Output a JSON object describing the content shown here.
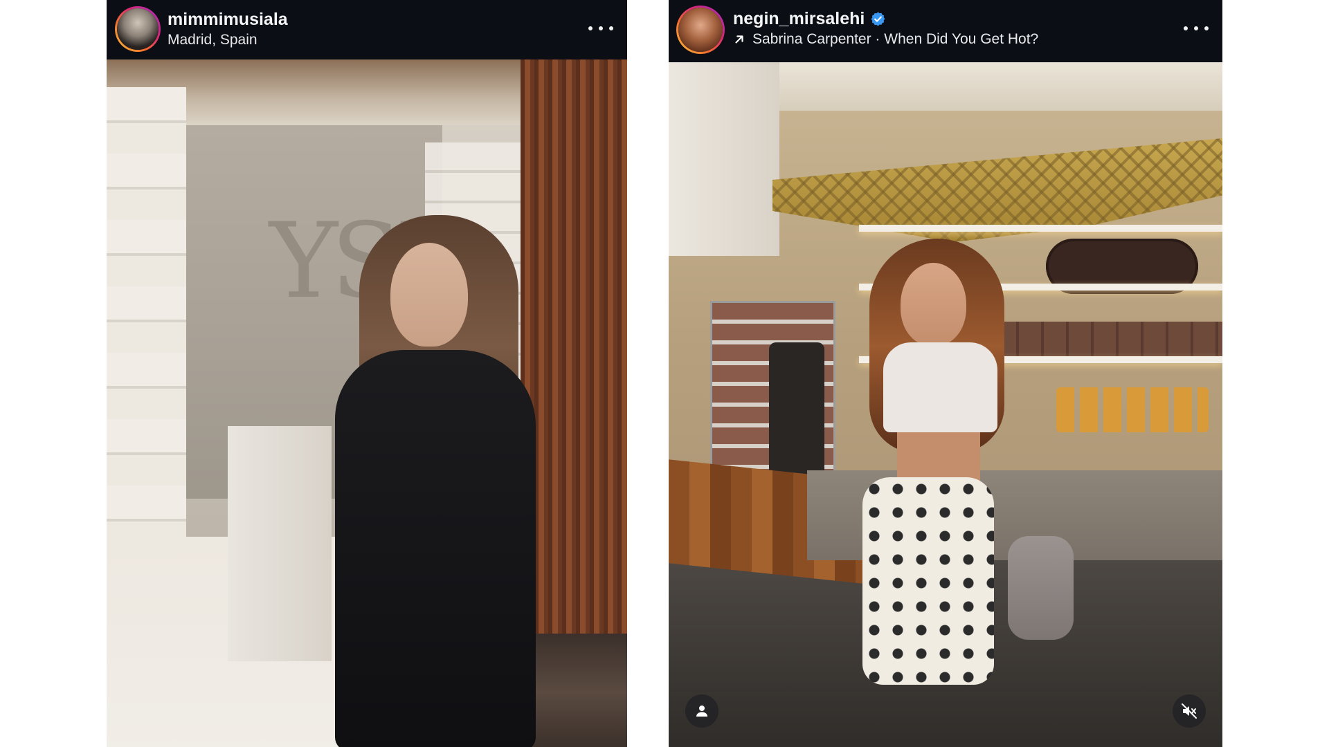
{
  "posts": [
    {
      "username": "mimmimusiala",
      "subline": "Madrid, Spain",
      "verified": false,
      "avatar": "avatar-photo",
      "more_icon": "more-options-icon"
    },
    {
      "username": "negin_mirsalehi",
      "subline": "Sabrina Carpenter · When Did You Get Hot?",
      "verified": true,
      "verified_icon": "verified-badge-icon",
      "audio_icon": "arrow-up-right-icon",
      "avatar": "avatar-photo",
      "more_icon": "more-options-icon",
      "overlay_icons": [
        "tagged-people-icon",
        "muted-audio-icon"
      ]
    }
  ],
  "colors": {
    "header_bg": "#0b0e15",
    "username_text": "#f4f5f7",
    "verified_blue": "#3897f0",
    "story_ring": [
      "#f9c33b",
      "#f56d2d",
      "#d9267a",
      "#9d2ec2"
    ]
  }
}
